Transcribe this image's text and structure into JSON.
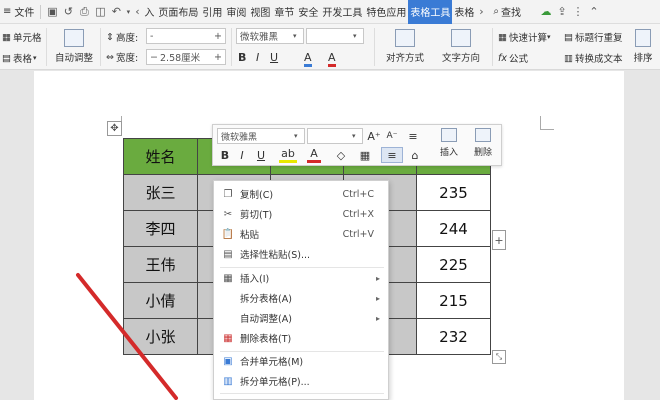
{
  "menubar": {
    "menu_icon": "≡",
    "file": "文件",
    "tabs": [
      "入",
      "页面布局",
      "引用",
      "审阅",
      "视图",
      "章节",
      "安全",
      "开发工具",
      "特色应用",
      "表格工具",
      "表格"
    ],
    "active_tab": "表格工具",
    "search": "查找"
  },
  "ribbon": {
    "cell_label": "单元格",
    "table_label": "表格",
    "auto_adjust": "自动调整",
    "height_label": "高度:",
    "height_value": "-",
    "width_label": "宽度:",
    "width_value": "2.58厘米",
    "font_name": "微软雅黑",
    "align_label": "对齐方式",
    "text_dir_label": "文字方向",
    "quick_calc": "快速计算",
    "formula": "公式",
    "title_repeat": "标题行重复",
    "convert_text": "转换成文本",
    "sort": "排序"
  },
  "table": {
    "header": "姓名",
    "rows": [
      {
        "name": "张三",
        "value": "235"
      },
      {
        "name": "李四",
        "value": "244"
      },
      {
        "name": "王伟",
        "value": "225"
      },
      {
        "name": "小倩",
        "value": "215"
      },
      {
        "name": "小张",
        "value": "232"
      }
    ]
  },
  "minibar": {
    "font_name": "微软雅黑",
    "insert": "插入",
    "delete": "删除"
  },
  "context_menu": {
    "copy": "复制(C)",
    "copy_key": "Ctrl+C",
    "cut": "剪切(T)",
    "cut_key": "Ctrl+X",
    "paste": "粘贴",
    "paste_key": "Ctrl+V",
    "paste_special": "选择性粘贴(S)...",
    "insert": "插入(I)",
    "split_table": "拆分表格(A)",
    "auto_adjust": "自动调整(A)",
    "delete_table": "删除表格(T)",
    "merge_cells": "合并单元格(M)",
    "split_cells": "拆分单元格(P)..."
  },
  "colors": {
    "header_green": "#6aab3f",
    "cell_gray": "#c8c8c8",
    "active_tab_blue": "#3a7bd5",
    "arrow_red": "#d42a2a"
  }
}
